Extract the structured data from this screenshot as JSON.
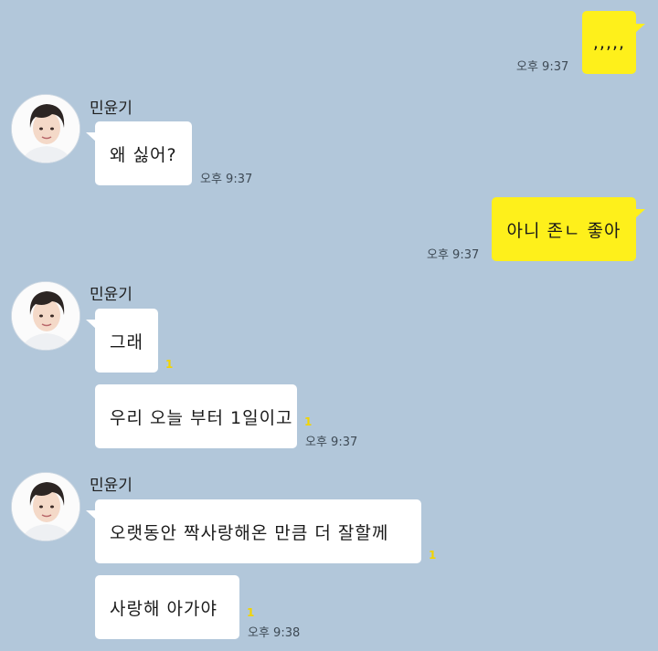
{
  "chat": {
    "messages": [
      {
        "side": "out",
        "text": ",,,,,",
        "time": "오후 9:37"
      },
      {
        "side": "in",
        "sender": "민윤기",
        "text": "왜 싫어?",
        "time": "오후 9:37"
      },
      {
        "side": "out",
        "text": "아니 존ㄴ 좋아",
        "time": "오후 9:37"
      },
      {
        "side": "in",
        "sender": "민윤기",
        "text": "그래",
        "unread": "1"
      },
      {
        "side": "in",
        "text": "우리 오늘 부터 1일이고",
        "unread": "1",
        "time": "오후 9:37"
      },
      {
        "side": "in",
        "sender": "민윤기",
        "text": "오랫동안 짝사랑해온 만큼 더 잘할께",
        "unread": "1"
      },
      {
        "side": "in",
        "text": "사랑해 아가야",
        "unread": "1",
        "time": "오후 9:38"
      }
    ]
  },
  "colors": {
    "background": "#b2c7da",
    "outgoing_bubble": "#fef01b",
    "incoming_bubble": "#ffffff",
    "unread_count": "#f2d400"
  },
  "icons": {
    "avatar": "profile-photo-icon"
  }
}
